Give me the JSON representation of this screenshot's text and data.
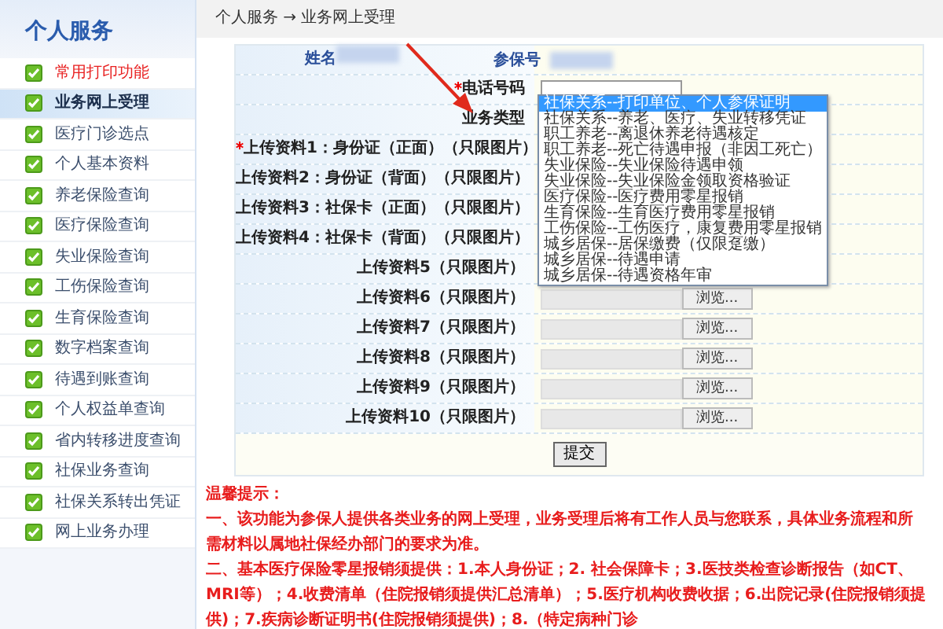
{
  "sidebar": {
    "title": "个人服务",
    "items": [
      {
        "label": "常用打印功能",
        "kind": "featured",
        "selected": false
      },
      {
        "label": "业务网上受理",
        "kind": "normal",
        "selected": true
      },
      {
        "label": "医疗门诊选点",
        "kind": "normal",
        "selected": false
      },
      {
        "label": "个人基本资料",
        "kind": "normal",
        "selected": false
      },
      {
        "label": "养老保险查询",
        "kind": "normal",
        "selected": false
      },
      {
        "label": "医疗保险查询",
        "kind": "normal",
        "selected": false
      },
      {
        "label": "失业保险查询",
        "kind": "normal",
        "selected": false
      },
      {
        "label": "工伤保险查询",
        "kind": "normal",
        "selected": false
      },
      {
        "label": "生育保险查询",
        "kind": "normal",
        "selected": false
      },
      {
        "label": "数字档案查询",
        "kind": "normal",
        "selected": false
      },
      {
        "label": "待遇到账查询",
        "kind": "normal",
        "selected": false
      },
      {
        "label": "个人权益单查询",
        "kind": "normal",
        "selected": false
      },
      {
        "label": "省内转移进度查询",
        "kind": "normal",
        "selected": false
      },
      {
        "label": "社保业务查询",
        "kind": "normal",
        "selected": false
      },
      {
        "label": "社保关系转出凭证",
        "kind": "normal",
        "selected": false
      },
      {
        "label": "网上业务办理",
        "kind": "normal",
        "selected": false
      }
    ]
  },
  "breadcrumb": "个人服务 → 业务网上受理",
  "form": {
    "rows": [
      {
        "kind": "pair",
        "label": "姓名",
        "label_2": "参保号",
        "required": false
      },
      {
        "kind": "text",
        "label": "电话号码",
        "required": true
      },
      {
        "kind": "select",
        "label": "业务类型",
        "required": false,
        "options": [
          {
            "label": "社保关系--打印单位、个人参保证明",
            "selected": true
          },
          {
            "label": "社保关系--养老、医疗、失业转移凭证",
            "selected": false
          },
          {
            "label": "职工养老--离退休养老待遇核定",
            "selected": false
          },
          {
            "label": "职工养老--死亡待遇申报（非因工死亡）",
            "selected": false
          },
          {
            "label": "失业保险--失业保险待遇申领",
            "selected": false
          },
          {
            "label": "失业保险--失业保险金领取资格验证",
            "selected": false
          },
          {
            "label": "医疗保险--医疗费用零星报销",
            "selected": false
          },
          {
            "label": "生育保险--生育医疗费用零星报销",
            "selected": false
          },
          {
            "label": "工伤保险--工伤医疗，康复费用零星报销",
            "selected": false
          },
          {
            "label": "城乡居保--居保缴费（仅限趸缴）",
            "selected": false
          },
          {
            "label": "城乡居保--待遇申请",
            "selected": false
          },
          {
            "label": "城乡居保--待遇资格年审",
            "selected": false
          }
        ]
      },
      {
        "kind": "file",
        "label": "上传资料1：身份证（正面）（只限图片）",
        "required": true
      },
      {
        "kind": "file",
        "label": "上传资料2：身份证（背面）（只限图片）",
        "required": false
      },
      {
        "kind": "file",
        "label": "上传资料3：社保卡（正面）（只限图片）",
        "required": false
      },
      {
        "kind": "file",
        "label": "上传资料4：社保卡（背面）（只限图片）",
        "required": false
      },
      {
        "kind": "file",
        "label": "上传资料5（只限图片）",
        "required": false
      },
      {
        "kind": "file",
        "label": "上传资料6（只限图片）",
        "required": false,
        "button": "浏览..."
      },
      {
        "kind": "file",
        "label": "上传资料7（只限图片）",
        "required": false,
        "button": "浏览..."
      },
      {
        "kind": "file",
        "label": "上传资料8（只限图片）",
        "required": false,
        "button": "浏览..."
      },
      {
        "kind": "file",
        "label": "上传资料9（只限图片）",
        "required": false,
        "button": "浏览..."
      },
      {
        "kind": "file",
        "label": "上传资料10（只限图片）",
        "required": false,
        "button": "浏览..."
      }
    ],
    "submit": "提交"
  },
  "notes": {
    "title": "温馨提示：",
    "paragraphs": [
      "一、该功能为参保人提供各类业务的网上受理，业务受理后将有工作人员与您联系，具体业务流程和所需材料以属地社保经办部门的要求为准。",
      "二、基本医疗保险零星报销须提供：1.本人身份证；2. 社会保障卡；3.医技类检查诊断报告（如CT、MRI等）；4.收费清单（住院报销须提供汇总清单）；5.医疗机构收费收据；6.出院记录(住院报销须提供)；7.疾病诊断证明书(住院报销须提供)；8.（特定病种门诊"
    ]
  }
}
